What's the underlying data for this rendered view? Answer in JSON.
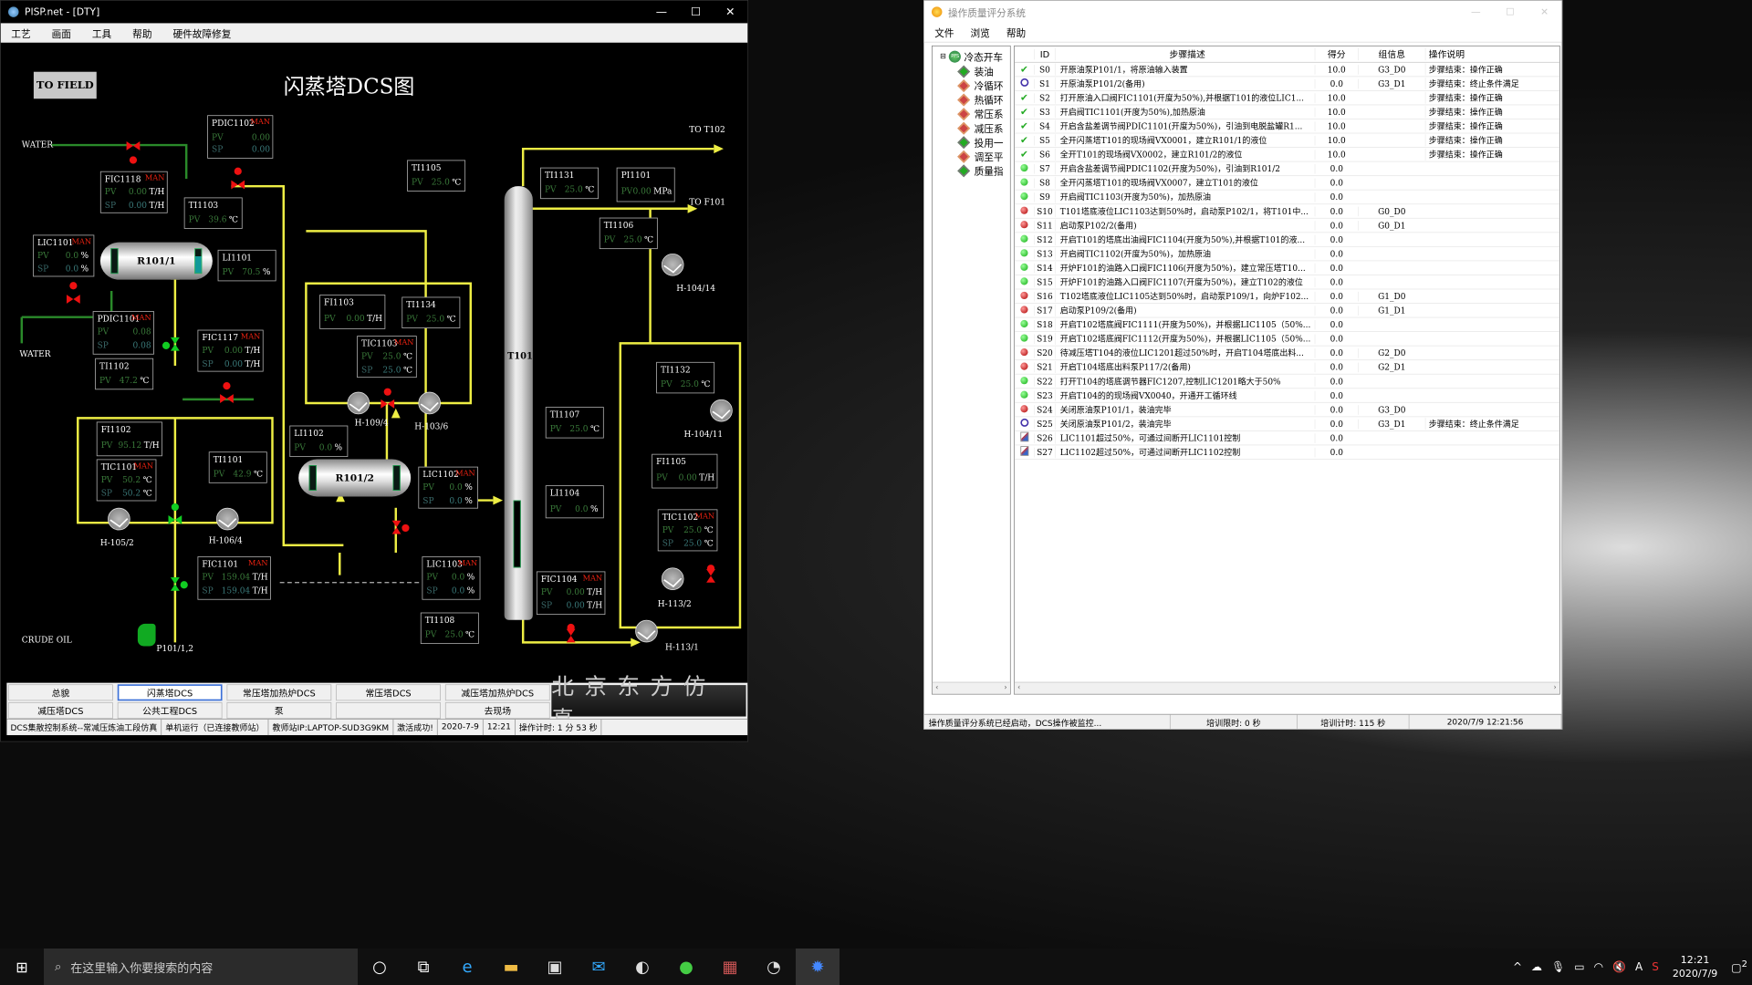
{
  "left_window": {
    "title": "PISP.net - [DTY]",
    "controls": {
      "minimize": "—",
      "maximize": "☐",
      "close": "✕"
    },
    "menu": [
      "工艺",
      "画面",
      "工具",
      "帮助",
      "硬件故障修复"
    ],
    "canvas": {
      "to_field": "TO FIELD",
      "title": "闪蒸塔DCS图",
      "labels": {
        "water_in": "WATER",
        "water_out": "WATER",
        "to_t102": "TO T102",
        "to_f101": "TO F101",
        "crude_oil": "CRUDE OIL",
        "pump": "P101/1,2",
        "h105": "H-105/2",
        "h106": "H-106/4",
        "h109": "H-109/4",
        "h103": "H-103/6",
        "h104_14": "H-104/14",
        "h104_11": "H-104/11",
        "h113_2": "H-113/2",
        "h113_1": "H-113/1"
      },
      "vessels": {
        "r101_1": "R101/1",
        "r101_2": "R101/2",
        "t101": "T101"
      },
      "instruments": {
        "pdic1102": {
          "tag": "PDIC1102",
          "mode": "MAN",
          "pv": "0.00",
          "sp": "0.00",
          "unit": ""
        },
        "fic1118": {
          "tag": "FIC1118",
          "mode": "MAN",
          "pv": "0.00",
          "sp": "0.00",
          "unit": "T/H"
        },
        "ti1103": {
          "tag": "TI1103",
          "pv": "39.6",
          "unit": "℃"
        },
        "lic1101": {
          "tag": "LIC1101",
          "mode": "MAN",
          "pv": "0.0",
          "sp": "0.0",
          "unit": "%"
        },
        "li1101": {
          "tag": "LI1101",
          "pv": "70.5",
          "unit": "%"
        },
        "pdic1101": {
          "tag": "PDIC1101",
          "mode": "MAN",
          "pv": "0.08",
          "sp": "0.08",
          "unit": ""
        },
        "fic1117": {
          "tag": "FIC1117",
          "mode": "MAN",
          "pv": "0.00",
          "sp": "0.00",
          "unit": "T/H"
        },
        "ti1102": {
          "tag": "TI1102",
          "pv": "47.2",
          "unit": "℃"
        },
        "fi1102": {
          "tag": "FI1102",
          "pv": "95.12",
          "unit": "T/H"
        },
        "tic1101": {
          "tag": "TIC1101",
          "mode": "MAN",
          "pv": "50.2",
          "sp": "50.2",
          "unit": "℃"
        },
        "ti1101": {
          "tag": "TI1101",
          "pv": "42.9",
          "unit": "℃"
        },
        "fic1101": {
          "tag": "FIC1101",
          "mode": "MAN",
          "pv": "159.04",
          "sp": "159.04",
          "unit": "T/H"
        },
        "ti1105": {
          "tag": "TI1105",
          "pv": "25.0",
          "unit": "℃"
        },
        "fi1103": {
          "tag": "FI1103",
          "pv": "0.00",
          "unit": "T/H"
        },
        "ti1134": {
          "tag": "TI1134",
          "pv": "25.0",
          "unit": "℃"
        },
        "tic1103": {
          "tag": "TIC1103",
          "mode": "MAN",
          "pv": "25.0",
          "sp": "25.0",
          "unit": "℃"
        },
        "li1102": {
          "tag": "LI1102",
          "pv": "0.0",
          "unit": "%"
        },
        "lic1102": {
          "tag": "LIC1102",
          "mode": "MAN",
          "pv": "0.0",
          "sp": "0.0",
          "unit": "%"
        },
        "lic1103": {
          "tag": "LIC1103",
          "mode": "MAN",
          "pv": "0.0",
          "sp": "0.0",
          "unit": "%"
        },
        "ti1108": {
          "tag": "TI1108",
          "pv": "25.0",
          "unit": "℃"
        },
        "ti1131": {
          "tag": "TI1131",
          "pv": "25.0",
          "unit": "℃"
        },
        "pi1101": {
          "tag": "PI1101",
          "pv": "0.00",
          "unit": "MPa"
        },
        "ti1106": {
          "tag": "TI1106",
          "pv": "25.0",
          "unit": "℃"
        },
        "ti1107": {
          "tag": "TI1107",
          "pv": "25.0",
          "unit": "℃"
        },
        "li1104": {
          "tag": "LI1104",
          "pv": "0.0",
          "unit": "%"
        },
        "fic1104": {
          "tag": "FIC1104",
          "mode": "MAN",
          "pv": "0.00",
          "sp": "0.00",
          "unit": "T/H"
        },
        "ti1132": {
          "tag": "TI1132",
          "pv": "25.0",
          "unit": "℃"
        },
        "fi1105": {
          "tag": "FI1105",
          "pv": "0.00",
          "unit": "T/H"
        },
        "tic1102": {
          "tag": "TIC1102",
          "mode": "MAN",
          "pv": "25.0",
          "sp": "25.0",
          "unit": "℃"
        }
      },
      "pv_label": "PV",
      "sp_label": "SP"
    },
    "nav": {
      "row1": [
        "总貌",
        "闪蒸塔DCS",
        "常压塔加热炉DCS",
        "常压塔DCS",
        "减压塔加热炉DCS"
      ],
      "row2": [
        "减压塔DCS",
        "公共工程DCS",
        "泵",
        "",
        "去现场"
      ],
      "active": "闪蒸塔DCS",
      "brand": "北京东方仿真"
    },
    "status": [
      "DCS集散控制系统--常减压炼油工段仿真",
      "单机运行（已连接教师站）",
      "教师站IP:LAPTOP-SUD3G9KM",
      "激活成功!",
      "2020-7-9",
      "12:21",
      "操作计时: 1 分 53 秒"
    ]
  },
  "right_window": {
    "title": "操作质量评分系统",
    "menu": [
      "文件",
      "浏览",
      "帮助"
    ],
    "tree": {
      "root": "冷态开车",
      "root_icon": "PFS",
      "nodes": [
        {
          "label": "装油",
          "state": "g"
        },
        {
          "label": "冷循环",
          "state": "r"
        },
        {
          "label": "热循环",
          "state": "r"
        },
        {
          "label": "常压系",
          "state": "r"
        },
        {
          "label": "减压系",
          "state": "r"
        },
        {
          "label": "投用一",
          "state": "g"
        },
        {
          "label": "调至平",
          "state": "r"
        },
        {
          "label": "质量指",
          "state": "g"
        }
      ]
    },
    "grid": {
      "headers": [
        "",
        "ID",
        "步骤描述",
        "得分",
        "组信息",
        "操作说明"
      ],
      "rows": [
        {
          "status": "ok",
          "id": "S0",
          "desc": "开原油泵P101/1，将原油输入装置",
          "score": "10.0",
          "group": "G3_D0",
          "note": "步骤结束：操作正确"
        },
        {
          "status": "ring",
          "id": "S1",
          "desc": "开原油泵P101/2(备用)",
          "score": "0.0",
          "group": "G3_D1",
          "note": "步骤结束：终止条件满足"
        },
        {
          "status": "ok",
          "id": "S2",
          "desc": "打开原油入口阀FIC1101(开度为50%),并根据T101的液位LIC1...",
          "score": "10.0",
          "group": "",
          "note": "步骤结束：操作正确"
        },
        {
          "status": "ok",
          "id": "S3",
          "desc": "开启阀TIC1101(开度为50%),加热原油",
          "score": "10.0",
          "group": "",
          "note": "步骤结束：操作正确"
        },
        {
          "status": "ok",
          "id": "S4",
          "desc": "开启含盐差调节阀PDIC1101(开度为50%)，引油到电脱盐罐R1...",
          "score": "10.0",
          "group": "",
          "note": "步骤结束：操作正确"
        },
        {
          "status": "ok",
          "id": "S5",
          "desc": "全开闪蒸塔T101的现场阀VX0001，建立R101/1的液位",
          "score": "10.0",
          "group": "",
          "note": "步骤结束：操作正确"
        },
        {
          "status": "ok",
          "id": "S6",
          "desc": "全开T101的现场阀VX0002，建立R101/2的液位",
          "score": "10.0",
          "group": "",
          "note": "步骤结束：操作正确"
        },
        {
          "status": "green",
          "id": "S7",
          "desc": "开启含盐差调节阀PDIC1102(开度为50%)，引油到R101/2",
          "score": "0.0",
          "group": "",
          "note": ""
        },
        {
          "status": "green",
          "id": "S8",
          "desc": "全开闪蒸塔T101的现场阀VX0007，建立T101的液位",
          "score": "0.0",
          "group": "",
          "note": ""
        },
        {
          "status": "green",
          "id": "S9",
          "desc": "开启阀TIC1103(开度为50%)，加热原油",
          "score": "0.0",
          "group": "",
          "note": ""
        },
        {
          "status": "red",
          "id": "S10",
          "desc": "T101塔底液位LIC1103达到50%时，启动泵P102/1，将T101中...",
          "score": "0.0",
          "group": "G0_D0",
          "note": ""
        },
        {
          "status": "red",
          "id": "S11",
          "desc": "启动泵P102/2(备用)",
          "score": "0.0",
          "group": "G0_D1",
          "note": ""
        },
        {
          "status": "green",
          "id": "S12",
          "desc": "开启T101的塔底出油阀FIC1104(开度为50%),并根据T101的液...",
          "score": "0.0",
          "group": "",
          "note": ""
        },
        {
          "status": "green",
          "id": "S13",
          "desc": "开启阀TIC1102(开度为50%)，加热原油",
          "score": "0.0",
          "group": "",
          "note": ""
        },
        {
          "status": "green",
          "id": "S14",
          "desc": "开炉F101的油路入口阀FIC1106(开度为50%)，建立常压塔T10...",
          "score": "0.0",
          "group": "",
          "note": ""
        },
        {
          "status": "green",
          "id": "S15",
          "desc": "开炉F101的油路入口阀FIC1107(开度为50%)，建立T102的液位",
          "score": "0.0",
          "group": "",
          "note": ""
        },
        {
          "status": "red",
          "id": "S16",
          "desc": "T102塔底液位LIC1105达到50%时，启动泵P109/1，向炉F102...",
          "score": "0.0",
          "group": "G1_D0",
          "note": ""
        },
        {
          "status": "red",
          "id": "S17",
          "desc": "启动泵P109/2(备用)",
          "score": "0.0",
          "group": "G1_D1",
          "note": ""
        },
        {
          "status": "green",
          "id": "S18",
          "desc": "开启T102塔底阀FIC1111(开度为50%)，并根据LIC1105（50%...",
          "score": "0.0",
          "group": "",
          "note": ""
        },
        {
          "status": "green",
          "id": "S19",
          "desc": "开启T102塔底阀FIC1112(开度为50%)，并根据LIC1105（50%...",
          "score": "0.0",
          "group": "",
          "note": ""
        },
        {
          "status": "red",
          "id": "S20",
          "desc": "待减压塔T104的液位LIC1201超过50%时，开启T104塔底出料...",
          "score": "0.0",
          "group": "G2_D0",
          "note": ""
        },
        {
          "status": "red",
          "id": "S21",
          "desc": "开启T104塔底出料泵P117/2(备用)",
          "score": "0.0",
          "group": "G2_D1",
          "note": ""
        },
        {
          "status": "green",
          "id": "S22",
          "desc": "打开T104的塔底调节器FIC1207,控制LIC1201略大于50%",
          "score": "0.0",
          "group": "",
          "note": ""
        },
        {
          "status": "green",
          "id": "S23",
          "desc": "开启T104的的现场阀VX0040，开通开工循环线",
          "score": "0.0",
          "group": "",
          "note": ""
        },
        {
          "status": "red",
          "id": "S24",
          "desc": "关闭原油泵P101/1，装油完毕",
          "score": "0.0",
          "group": "G3_D0",
          "note": ""
        },
        {
          "status": "ring",
          "id": "S25",
          "desc": "关闭原油泵P101/2，装油完毕",
          "score": "0.0",
          "group": "G3_D1",
          "note": "步骤结束：终止条件满足"
        },
        {
          "status": "doc",
          "id": "S26",
          "desc": "LIC1101超过50%，可通过间断开LIC1101控制",
          "score": "0.0",
          "group": "",
          "note": ""
        },
        {
          "status": "doc",
          "id": "S27",
          "desc": "LIC1102超过50%，可通过间断开LIC1102控制",
          "score": "0.0",
          "group": "",
          "note": ""
        }
      ]
    },
    "status": [
      "操作质量评分系统已经启动，DCS操作被监控...",
      "培训限时: 0 秒",
      "培训计时: 115 秒",
      "2020/7/9 12:21:56"
    ]
  },
  "taskbar": {
    "search_placeholder": "在这里输入你要搜索的内容",
    "time": "12:21",
    "date": "2020/7/9",
    "ime": "A",
    "notifications": "2"
  }
}
